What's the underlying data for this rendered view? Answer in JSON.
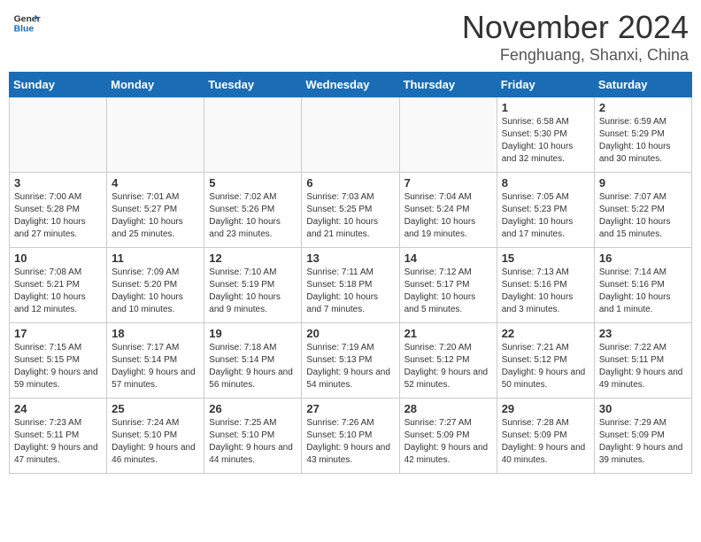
{
  "header": {
    "logo_general": "General",
    "logo_blue": "Blue",
    "month": "November 2024",
    "location": "Fenghuang, Shanxi, China"
  },
  "weekdays": [
    "Sunday",
    "Monday",
    "Tuesday",
    "Wednesday",
    "Thursday",
    "Friday",
    "Saturday"
  ],
  "weeks": [
    [
      {
        "day": "",
        "info": ""
      },
      {
        "day": "",
        "info": ""
      },
      {
        "day": "",
        "info": ""
      },
      {
        "day": "",
        "info": ""
      },
      {
        "day": "",
        "info": ""
      },
      {
        "day": "1",
        "info": "Sunrise: 6:58 AM\nSunset: 5:30 PM\nDaylight: 10 hours and 32 minutes."
      },
      {
        "day": "2",
        "info": "Sunrise: 6:59 AM\nSunset: 5:29 PM\nDaylight: 10 hours and 30 minutes."
      }
    ],
    [
      {
        "day": "3",
        "info": "Sunrise: 7:00 AM\nSunset: 5:28 PM\nDaylight: 10 hours and 27 minutes."
      },
      {
        "day": "4",
        "info": "Sunrise: 7:01 AM\nSunset: 5:27 PM\nDaylight: 10 hours and 25 minutes."
      },
      {
        "day": "5",
        "info": "Sunrise: 7:02 AM\nSunset: 5:26 PM\nDaylight: 10 hours and 23 minutes."
      },
      {
        "day": "6",
        "info": "Sunrise: 7:03 AM\nSunset: 5:25 PM\nDaylight: 10 hours and 21 minutes."
      },
      {
        "day": "7",
        "info": "Sunrise: 7:04 AM\nSunset: 5:24 PM\nDaylight: 10 hours and 19 minutes."
      },
      {
        "day": "8",
        "info": "Sunrise: 7:05 AM\nSunset: 5:23 PM\nDaylight: 10 hours and 17 minutes."
      },
      {
        "day": "9",
        "info": "Sunrise: 7:07 AM\nSunset: 5:22 PM\nDaylight: 10 hours and 15 minutes."
      }
    ],
    [
      {
        "day": "10",
        "info": "Sunrise: 7:08 AM\nSunset: 5:21 PM\nDaylight: 10 hours and 12 minutes."
      },
      {
        "day": "11",
        "info": "Sunrise: 7:09 AM\nSunset: 5:20 PM\nDaylight: 10 hours and 10 minutes."
      },
      {
        "day": "12",
        "info": "Sunrise: 7:10 AM\nSunset: 5:19 PM\nDaylight: 10 hours and 9 minutes."
      },
      {
        "day": "13",
        "info": "Sunrise: 7:11 AM\nSunset: 5:18 PM\nDaylight: 10 hours and 7 minutes."
      },
      {
        "day": "14",
        "info": "Sunrise: 7:12 AM\nSunset: 5:17 PM\nDaylight: 10 hours and 5 minutes."
      },
      {
        "day": "15",
        "info": "Sunrise: 7:13 AM\nSunset: 5:16 PM\nDaylight: 10 hours and 3 minutes."
      },
      {
        "day": "16",
        "info": "Sunrise: 7:14 AM\nSunset: 5:16 PM\nDaylight: 10 hours and 1 minute."
      }
    ],
    [
      {
        "day": "17",
        "info": "Sunrise: 7:15 AM\nSunset: 5:15 PM\nDaylight: 9 hours and 59 minutes."
      },
      {
        "day": "18",
        "info": "Sunrise: 7:17 AM\nSunset: 5:14 PM\nDaylight: 9 hours and 57 minutes."
      },
      {
        "day": "19",
        "info": "Sunrise: 7:18 AM\nSunset: 5:14 PM\nDaylight: 9 hours and 56 minutes."
      },
      {
        "day": "20",
        "info": "Sunrise: 7:19 AM\nSunset: 5:13 PM\nDaylight: 9 hours and 54 minutes."
      },
      {
        "day": "21",
        "info": "Sunrise: 7:20 AM\nSunset: 5:12 PM\nDaylight: 9 hours and 52 minutes."
      },
      {
        "day": "22",
        "info": "Sunrise: 7:21 AM\nSunset: 5:12 PM\nDaylight: 9 hours and 50 minutes."
      },
      {
        "day": "23",
        "info": "Sunrise: 7:22 AM\nSunset: 5:11 PM\nDaylight: 9 hours and 49 minutes."
      }
    ],
    [
      {
        "day": "24",
        "info": "Sunrise: 7:23 AM\nSunset: 5:11 PM\nDaylight: 9 hours and 47 minutes."
      },
      {
        "day": "25",
        "info": "Sunrise: 7:24 AM\nSunset: 5:10 PM\nDaylight: 9 hours and 46 minutes."
      },
      {
        "day": "26",
        "info": "Sunrise: 7:25 AM\nSunset: 5:10 PM\nDaylight: 9 hours and 44 minutes."
      },
      {
        "day": "27",
        "info": "Sunrise: 7:26 AM\nSunset: 5:10 PM\nDaylight: 9 hours and 43 minutes."
      },
      {
        "day": "28",
        "info": "Sunrise: 7:27 AM\nSunset: 5:09 PM\nDaylight: 9 hours and 42 minutes."
      },
      {
        "day": "29",
        "info": "Sunrise: 7:28 AM\nSunset: 5:09 PM\nDaylight: 9 hours and 40 minutes."
      },
      {
        "day": "30",
        "info": "Sunrise: 7:29 AM\nSunset: 5:09 PM\nDaylight: 9 hours and 39 minutes."
      }
    ]
  ]
}
